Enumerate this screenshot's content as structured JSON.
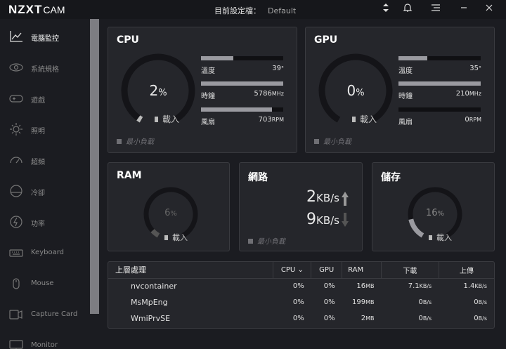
{
  "app": {
    "logo_main": "NZXT",
    "logo_sub": "CAM"
  },
  "header": {
    "profile_label": "目前設定檔：",
    "profile_value": "Default"
  },
  "sidebar": {
    "items": [
      {
        "label": "電腦監控",
        "icon": "monitor-chart-icon",
        "active": true
      },
      {
        "label": "系統規格",
        "icon": "eye-icon"
      },
      {
        "label": "遊戲",
        "icon": "gamepad-icon"
      },
      {
        "label": "照明",
        "icon": "light-icon"
      },
      {
        "label": "超頻",
        "icon": "speedometer-icon"
      },
      {
        "label": "冷卻",
        "icon": "fan-icon"
      },
      {
        "label": "功率",
        "icon": "power-icon"
      },
      {
        "label": "Keyboard",
        "icon": "keyboard-icon"
      },
      {
        "label": "Mouse",
        "icon": "mouse-icon"
      },
      {
        "label": "Capture Card",
        "icon": "capture-card-icon"
      },
      {
        "label": "Monitor",
        "icon": "monitor-icon"
      }
    ]
  },
  "cpu": {
    "title": "CPU",
    "load": "2",
    "load_unit": "%",
    "load_fraction": 0.02,
    "sub": "載入",
    "metrics": [
      {
        "label": "溫度",
        "value": "39",
        "unit": "°",
        "fraction": 0.39
      },
      {
        "label": "時鐘",
        "value": "5786",
        "unit": "MHz",
        "fraction": 1.0
      },
      {
        "label": "風扇",
        "value": "703",
        "unit": "RPM",
        "fraction": 0.86
      }
    ],
    "mini": "最小負載"
  },
  "gpu": {
    "title": "GPU",
    "load": "0",
    "load_unit": "%",
    "load_fraction": 0.0,
    "sub": "載入",
    "metrics": [
      {
        "label": "溫度",
        "value": "35",
        "unit": "°",
        "fraction": 0.35
      },
      {
        "label": "時鐘",
        "value": "210",
        "unit": "MHz",
        "fraction": 1.0
      },
      {
        "label": "風扇",
        "value": "0",
        "unit": "RPM",
        "fraction": 0.0
      }
    ],
    "mini": "最小負載"
  },
  "ram": {
    "title": "RAM",
    "load": "6",
    "unit": "%",
    "fraction": 0.06,
    "sub": "載入"
  },
  "network": {
    "title": "網路",
    "down": "2",
    "down_unit": "KB/s",
    "up": "9",
    "up_unit": "KB/s",
    "mini": "最小負載"
  },
  "storage": {
    "title": "儲存",
    "load": "16",
    "unit": "%",
    "fraction": 0.16,
    "sub": "載入"
  },
  "processes": {
    "headers": {
      "name": "上層處理",
      "cpu": "CPU",
      "gpu": "GPU",
      "ram": "RAM",
      "down": "下載",
      "up": "上傳"
    },
    "rows": [
      {
        "name": "nvcontainer",
        "cpu": "0%",
        "gpu": "0%",
        "ram": "16",
        "ram_unit": "MB",
        "down": "7.1",
        "down_unit": "KB/s",
        "up": "1.4",
        "up_unit": "KB/s"
      },
      {
        "name": "MsMpEng",
        "cpu": "0%",
        "gpu": "0%",
        "ram": "199",
        "ram_unit": "MB",
        "down": "0",
        "down_unit": "B/s",
        "up": "0",
        "up_unit": "B/s"
      },
      {
        "name": "WmiPrvSE",
        "cpu": "0%",
        "gpu": "0%",
        "ram": "2",
        "ram_unit": "MB",
        "down": "0",
        "down_unit": "B/s",
        "up": "0",
        "up_unit": "B/s"
      }
    ]
  }
}
